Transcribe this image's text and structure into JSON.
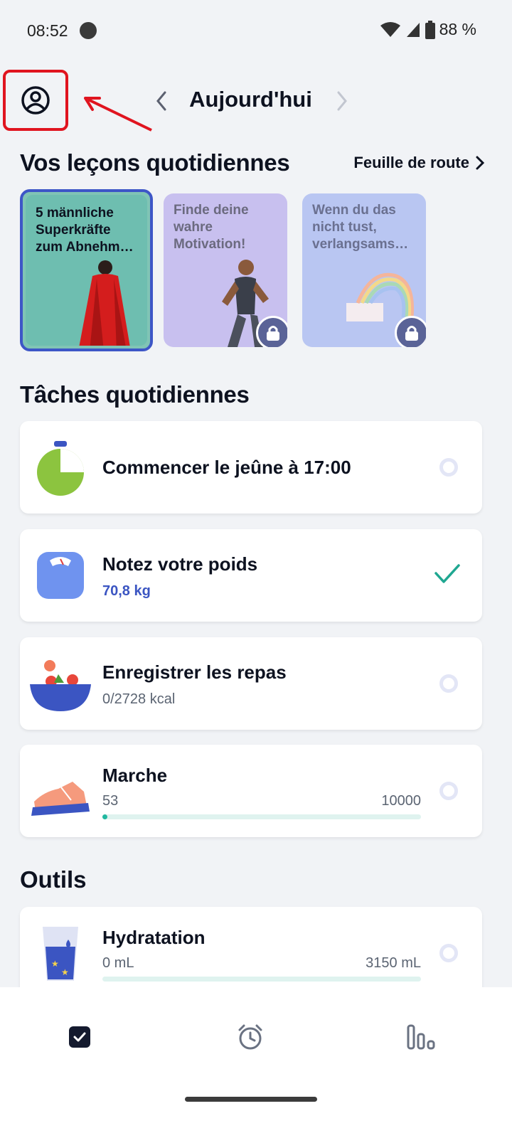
{
  "status_bar": {
    "time": "08:52",
    "battery": "88 %"
  },
  "header": {
    "title": "Aujourd'hui"
  },
  "lessons": {
    "title": "Vos leçons quotidiennes",
    "roadmap_label": "Feuille de route",
    "cards": [
      {
        "text": "5 männliche Superkräfte zum Abnehm…",
        "locked": false
      },
      {
        "text": "Finde deine wahre Motivation!",
        "locked": true
      },
      {
        "text": "Wenn du das nicht tust, verlangsams…",
        "locked": true
      }
    ]
  },
  "tasks": {
    "title": "Tâches quotidiennes",
    "items": [
      {
        "title": "Commencer le jeûne à 17:00",
        "icon": "fasting-timer-icon",
        "done": false
      },
      {
        "title": "Notez votre poids",
        "subtitle": "70,8 kg",
        "icon": "scale-icon",
        "done": true
      },
      {
        "title": "Enregistrer les repas",
        "subtitle": "0/2728 kcal",
        "icon": "salad-bowl-icon",
        "done": false
      },
      {
        "title": "Marche",
        "current": "53",
        "goal": "10000",
        "progress_fraction": 0.0053,
        "icon": "sneaker-icon",
        "done": false
      }
    ]
  },
  "tools": {
    "title": "Outils",
    "items": [
      {
        "title": "Hydratation",
        "current": "0 mL",
        "goal": "3150 mL",
        "progress_fraction": 0,
        "icon": "water-glass-icon"
      }
    ]
  },
  "bottom_nav": [
    {
      "name": "tasks",
      "icon": "checkbox-icon",
      "active": true
    },
    {
      "name": "fasting",
      "icon": "alarm-clock-icon",
      "active": false
    },
    {
      "name": "stats",
      "icon": "bar-chart-icon",
      "active": false
    }
  ],
  "colors": {
    "accent": "#3d56c7",
    "teal": "#22b8a0",
    "annotation": "#e0141f"
  }
}
